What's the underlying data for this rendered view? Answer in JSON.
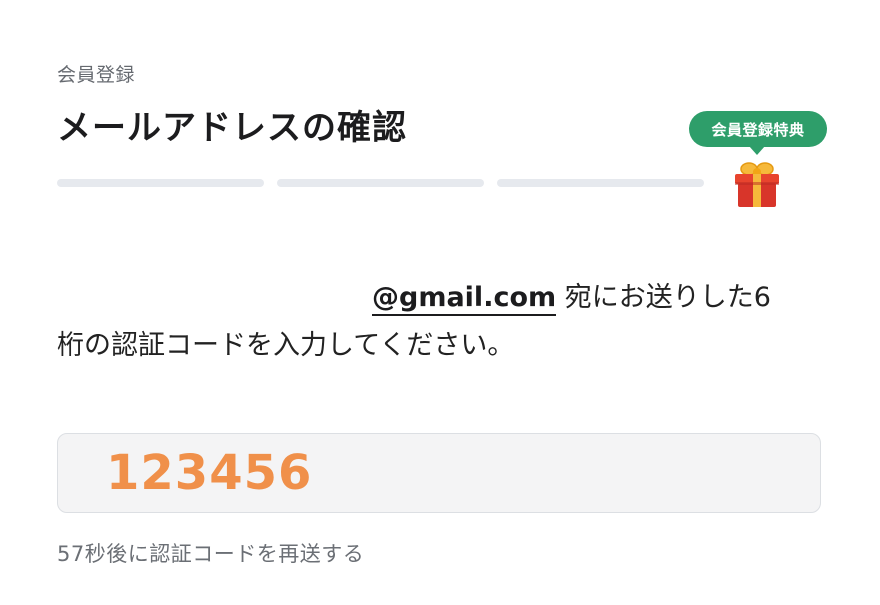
{
  "header": {
    "step_label": "会員登録",
    "title": "メールアドレスの確認"
  },
  "progress": {
    "total_steps": 3,
    "completed_steps": 0
  },
  "bonus": {
    "badge_label": "会員登録特典",
    "icon": "gift-icon"
  },
  "message": {
    "email": "@gmail.com",
    "line1_suffix": " 宛にお送りした6",
    "line2": "桁の認証コードを入力してください。"
  },
  "code_input": {
    "value": "123456"
  },
  "resend": {
    "label": "57秒後に認証コードを再送する"
  },
  "colors": {
    "badge_green": "#2e9e6a",
    "code_orange": "#f0904a",
    "progress_track": "#e6e9ee"
  }
}
